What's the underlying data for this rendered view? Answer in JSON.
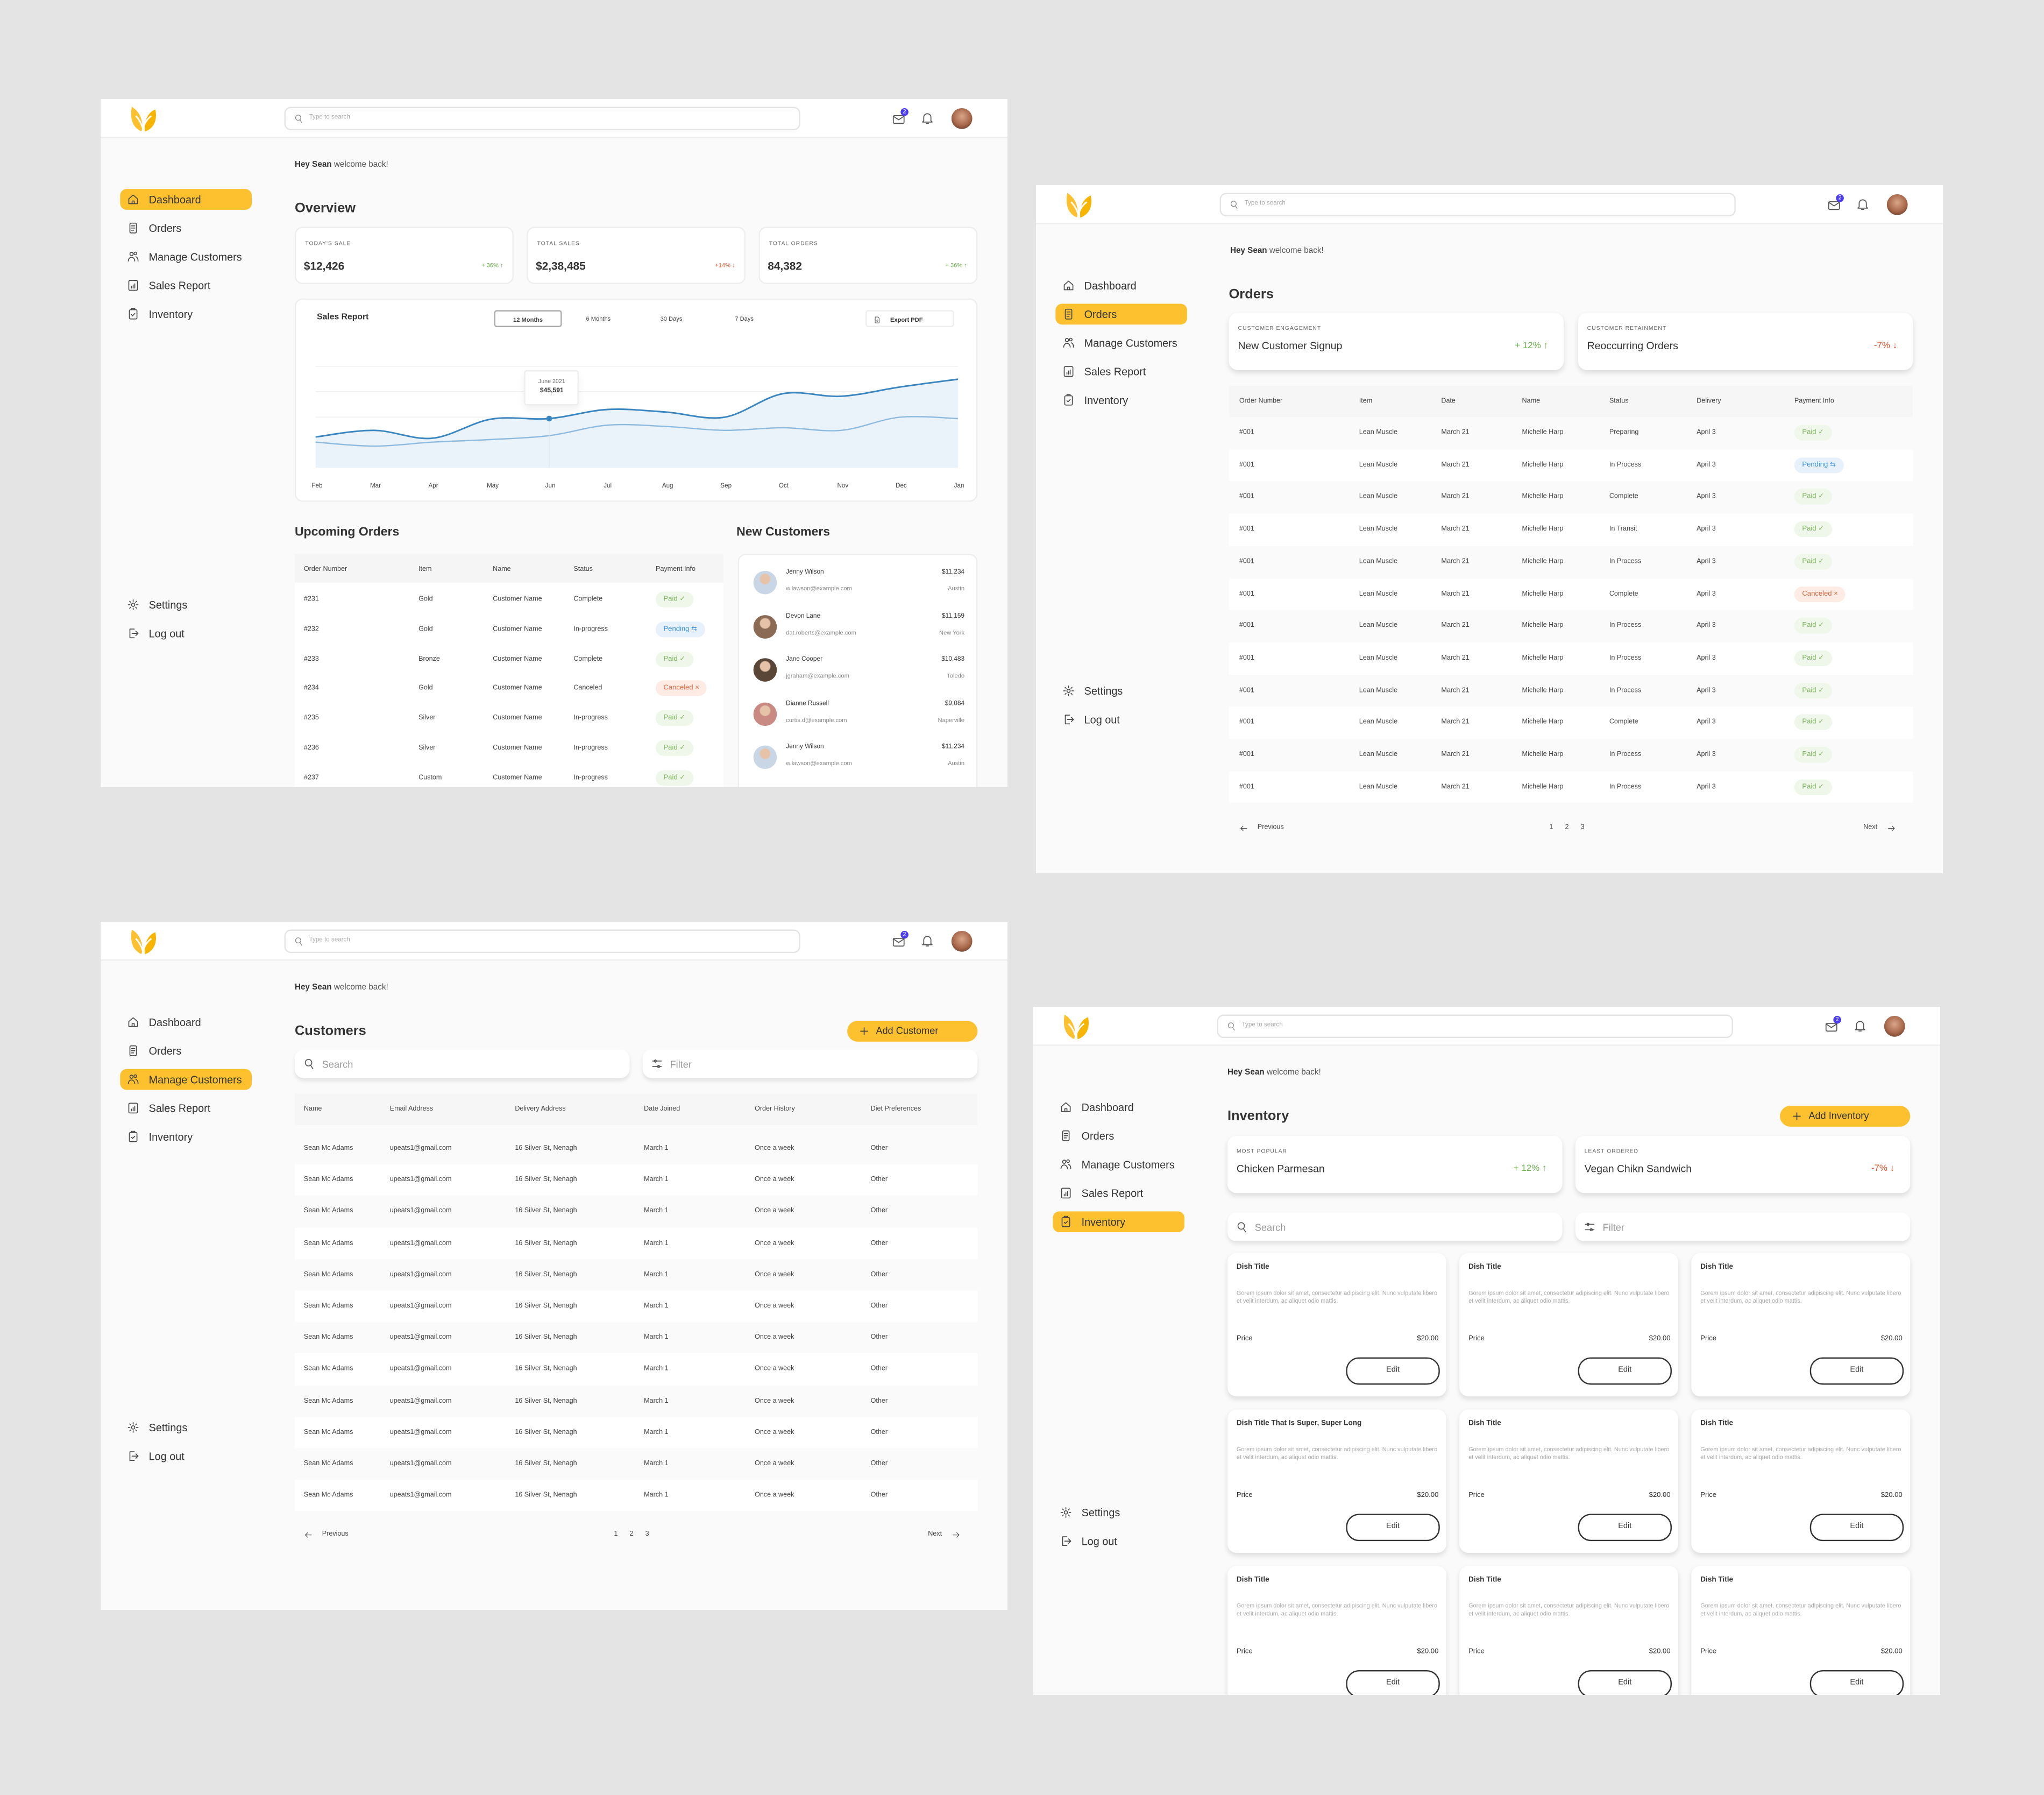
{
  "app": {
    "greeting_name": "Hey Sean",
    "greeting_rest": "welcome back!",
    "search_placeholder": "Type to search",
    "notification_count": "2"
  },
  "colors": {
    "accent": "#fdc02f",
    "positive": "#6ab04c",
    "negative": "#e0542b",
    "chart_primary": "#3a86c1",
    "chart_secondary": "#8dbbe0",
    "pending": "#3d8fdb"
  },
  "sidebar": {
    "items": [
      {
        "label": "Dashboard",
        "icon": "home-icon"
      },
      {
        "label": "Orders",
        "icon": "orders-icon"
      },
      {
        "label": "Manage Customers",
        "icon": "users-icon"
      },
      {
        "label": "Sales Report",
        "icon": "chart-icon"
      },
      {
        "label": "Inventory",
        "icon": "clipboard-icon"
      }
    ],
    "bottom": [
      {
        "label": "Settings",
        "icon": "gear-icon"
      },
      {
        "label": "Log out",
        "icon": "logout-icon"
      }
    ]
  },
  "dashboard": {
    "title": "Overview",
    "stats": [
      {
        "label": "TODAY'S SALE",
        "value": "$12,426",
        "change": "+ 36%",
        "trend": "up"
      },
      {
        "label": "TOTAL SALES",
        "value": "$2,38,485",
        "change": "+14%",
        "trend": "down"
      },
      {
        "label": "TOTAL ORDERS",
        "value": "84,382",
        "change": "+ 36%",
        "trend": "up"
      }
    ],
    "sales_report": {
      "title": "Sales Report",
      "ranges": [
        "12 Months",
        "6 Months",
        "30 Days",
        "7 Days"
      ],
      "active_range": "12 Months",
      "export_label": "Export PDF",
      "tooltip": {
        "label": "June 2021",
        "value": "$45,591"
      }
    },
    "upcoming_orders": {
      "title": "Upcoming Orders",
      "columns": [
        "Order Number",
        "Item",
        "Name",
        "Status",
        "Payment Info"
      ],
      "rows": [
        [
          "#231",
          "Gold",
          "Customer Name",
          "Complete",
          "Paid"
        ],
        [
          "#232",
          "Gold",
          "Customer Name",
          "In-progress",
          "Pending"
        ],
        [
          "#233",
          "Bronze",
          "Customer Name",
          "Complete",
          "Paid"
        ],
        [
          "#234",
          "Gold",
          "Customer Name",
          "Canceled",
          "Canceled"
        ],
        [
          "#235",
          "Silver",
          "Customer Name",
          "In-progress",
          "Paid"
        ],
        [
          "#236",
          "Silver",
          "Customer Name",
          "In-progress",
          "Paid"
        ],
        [
          "#237",
          "Custom",
          "Customer Name",
          "In-progress",
          "Paid"
        ]
      ]
    },
    "new_customers": {
      "title": "New Customers",
      "items": [
        {
          "name": "Jenny Wilson",
          "email": "w.lawson@example.com",
          "amount": "$11,234",
          "city": "Austin"
        },
        {
          "name": "Devon Lane",
          "email": "dat.roberts@example.com",
          "amount": "$11,159",
          "city": "New York"
        },
        {
          "name": "Jane Cooper",
          "email": "jgraham@example.com",
          "amount": "$10,483",
          "city": "Toledo"
        },
        {
          "name": "Dianne Russell",
          "email": "curtis.d@example.com",
          "amount": "$9,084",
          "city": "Naperville"
        },
        {
          "name": "Jenny Wilson",
          "email": "w.lawson@example.com",
          "amount": "$11,234",
          "city": "Austin"
        }
      ]
    }
  },
  "chart_data": {
    "type": "area",
    "title": "Sales Report",
    "categories": [
      "Feb",
      "Mar",
      "Apr",
      "May",
      "Jun",
      "Jul",
      "Aug",
      "Sep",
      "Oct",
      "Nov",
      "Dec",
      "Jan"
    ],
    "series": [
      {
        "values": [
          28600,
          34700,
          27400,
          45000,
          45591,
          54000,
          51600,
          46800,
          68600,
          66200,
          74700,
          82000
        ]
      },
      {
        "values": [
          23800,
          20100,
          23800,
          26200,
          29800,
          39500,
          38300,
          34700,
          37100,
          34700,
          46800,
          45600
        ]
      }
    ],
    "ylim": [
      0,
      94000
    ],
    "grid": true,
    "legend": "none",
    "annotation": {
      "category": "Jun",
      "label": "June 2021",
      "value": "$45,591"
    }
  },
  "orders": {
    "title": "Orders",
    "cards": [
      {
        "label": "CUSTOMER ENGAGEMENT",
        "value": "New Customer Signup",
        "change": "+ 12%",
        "trend": "up"
      },
      {
        "label": "CUSTOMER RETAINMENT",
        "value": "Reoccurring Orders",
        "change": "-7%",
        "trend": "down"
      }
    ],
    "columns": [
      "Order Number",
      "Item",
      "Date",
      "Name",
      "Status",
      "Delivery",
      "Payment Info"
    ],
    "rows": [
      [
        "#001",
        "Lean Muscle",
        "March 21",
        "Michelle Harp",
        "Preparing",
        "April 3",
        "Paid"
      ],
      [
        "#001",
        "Lean Muscle",
        "March 21",
        "Michelle Harp",
        "In Process",
        "April 3",
        "Pending"
      ],
      [
        "#001",
        "Lean Muscle",
        "March 21",
        "Michelle Harp",
        "Complete",
        "April 3",
        "Paid"
      ],
      [
        "#001",
        "Lean Muscle",
        "March 21",
        "Michelle Harp",
        "In Transit",
        "April 3",
        "Paid"
      ],
      [
        "#001",
        "Lean Muscle",
        "March 21",
        "Michelle Harp",
        "In Process",
        "April 3",
        "Paid"
      ],
      [
        "#001",
        "Lean Muscle",
        "March 21",
        "Michelle Harp",
        "Complete",
        "April 3",
        "Canceled"
      ],
      [
        "#001",
        "Lean Muscle",
        "March 21",
        "Michelle Harp",
        "In Process",
        "April 3",
        "Paid"
      ],
      [
        "#001",
        "Lean Muscle",
        "March 21",
        "Michelle Harp",
        "In Process",
        "April 3",
        "Paid"
      ],
      [
        "#001",
        "Lean Muscle",
        "March 21",
        "Michelle Harp",
        "In Process",
        "April 3",
        "Paid"
      ],
      [
        "#001",
        "Lean Muscle",
        "March 21",
        "Michelle Harp",
        "Complete",
        "April 3",
        "Paid"
      ],
      [
        "#001",
        "Lean Muscle",
        "March 21",
        "Michelle Harp",
        "In Process",
        "April 3",
        "Paid"
      ],
      [
        "#001",
        "Lean Muscle",
        "March 21",
        "Michelle Harp",
        "In Process",
        "April 3",
        "Paid"
      ]
    ],
    "pagination": {
      "previous": "Previous",
      "next": "Next",
      "pages": [
        "1",
        "2",
        "3"
      ]
    }
  },
  "customers": {
    "title": "Customers",
    "add_label": "Add Customer",
    "search_placeholder": "Search",
    "filter_placeholder": "Filter",
    "columns": [
      "Name",
      "Email Address",
      "Delivery Address",
      "Date Joined",
      "Order History",
      "Diet Preferences"
    ],
    "rows": [
      [
        "Sean Mc Adams",
        "upeats1@gmail.com",
        "16 Silver St, Nenagh",
        "March 1",
        "Once a week",
        "Other"
      ],
      [
        "Sean Mc Adams",
        "upeats1@gmail.com",
        "16 Silver St, Nenagh",
        "March 1",
        "Once a week",
        "Other"
      ],
      [
        "Sean Mc Adams",
        "upeats1@gmail.com",
        "16 Silver St, Nenagh",
        "March 1",
        "Once a week",
        "Other"
      ],
      [
        "Sean Mc Adams",
        "upeats1@gmail.com",
        "16 Silver St, Nenagh",
        "March 1",
        "Once a week",
        "Other"
      ],
      [
        "Sean Mc Adams",
        "upeats1@gmail.com",
        "16 Silver St, Nenagh",
        "March 1",
        "Once a week",
        "Other"
      ],
      [
        "Sean Mc Adams",
        "upeats1@gmail.com",
        "16 Silver St, Nenagh",
        "March 1",
        "Once a week",
        "Other"
      ],
      [
        "Sean Mc Adams",
        "upeats1@gmail.com",
        "16 Silver St, Nenagh",
        "March 1",
        "Once a week",
        "Other"
      ],
      [
        "Sean Mc Adams",
        "upeats1@gmail.com",
        "16 Silver St, Nenagh",
        "March 1",
        "Once a week",
        "Other"
      ],
      [
        "Sean Mc Adams",
        "upeats1@gmail.com",
        "16 Silver St, Nenagh",
        "March 1",
        "Once a week",
        "Other"
      ],
      [
        "Sean Mc Adams",
        "upeats1@gmail.com",
        "16 Silver St, Nenagh",
        "March 1",
        "Once a week",
        "Other"
      ],
      [
        "Sean Mc Adams",
        "upeats1@gmail.com",
        "16 Silver St, Nenagh",
        "March 1",
        "Once a week",
        "Other"
      ],
      [
        "Sean Mc Adams",
        "upeats1@gmail.com",
        "16 Silver St, Nenagh",
        "March 1",
        "Once a week",
        "Other"
      ]
    ],
    "pagination": {
      "previous": "Previous",
      "next": "Next",
      "pages": [
        "1",
        "2",
        "3"
      ]
    }
  },
  "inventory": {
    "title": "Inventory",
    "add_label": "Add Inventory",
    "search_placeholder": "Search",
    "filter_placeholder": "Filter",
    "cards": [
      {
        "label": "MOST POPULAR",
        "value": "Chicken Parmesan",
        "change": "+ 12%",
        "trend": "up"
      },
      {
        "label": "LEAST ORDERED",
        "value": "Vegan Chikn Sandwich",
        "change": "-7%",
        "trend": "down"
      }
    ],
    "dishes": [
      {
        "title": "Dish Title",
        "description": "Gorem ipsum dolor sit amet, consectetur adipiscing elit. Nunc vulputate libero et velit interdum, ac aliquet odio mattis.",
        "price_label": "Price",
        "price": "$20.00",
        "edit_label": "Edit"
      },
      {
        "title": "Dish Title",
        "description": "Gorem ipsum dolor sit amet, consectetur adipiscing elit. Nunc vulputate libero et velit interdum, ac aliquet odio mattis.",
        "price_label": "Price",
        "price": "$20.00",
        "edit_label": "Edit"
      },
      {
        "title": "Dish Title",
        "description": "Gorem ipsum dolor sit amet, consectetur adipiscing elit. Nunc vulputate libero et velit interdum, ac aliquet odio mattis.",
        "price_label": "Price",
        "price": "$20.00",
        "edit_label": "Edit"
      },
      {
        "title": "Dish Title That Is Super, Super Long",
        "description": "Gorem ipsum dolor sit amet, consectetur adipiscing elit. Nunc vulputate libero et velit interdum, ac aliquet odio mattis.",
        "price_label": "Price",
        "price": "$20.00",
        "edit_label": "Edit"
      },
      {
        "title": "Dish Title",
        "description": "Gorem ipsum dolor sit amet, consectetur adipiscing elit. Nunc vulputate libero et velit interdum, ac aliquet odio mattis.",
        "price_label": "Price",
        "price": "$20.00",
        "edit_label": "Edit"
      },
      {
        "title": "Dish Title",
        "description": "Gorem ipsum dolor sit amet, consectetur adipiscing elit. Nunc vulputate libero et velit interdum, ac aliquet odio mattis.",
        "price_label": "Price",
        "price": "$20.00",
        "edit_label": "Edit"
      },
      {
        "title": "Dish Title",
        "description": "Gorem ipsum dolor sit amet, consectetur adipiscing elit. Nunc vulputate libero et velit interdum, ac aliquet odio mattis.",
        "price_label": "Price",
        "price": "$20.00",
        "edit_label": "Edit"
      },
      {
        "title": "Dish Title",
        "description": "Gorem ipsum dolor sit amet, consectetur adipiscing elit. Nunc vulputate libero et velit interdum, ac aliquet odio mattis.",
        "price_label": "Price",
        "price": "$20.00",
        "edit_label": "Edit"
      },
      {
        "title": "Dish Title",
        "description": "Gorem ipsum dolor sit amet, consectetur adipiscing elit. Nunc vulputate libero et velit interdum, ac aliquet odio mattis.",
        "price_label": "Price",
        "price": "$20.00",
        "edit_label": "Edit"
      }
    ]
  }
}
